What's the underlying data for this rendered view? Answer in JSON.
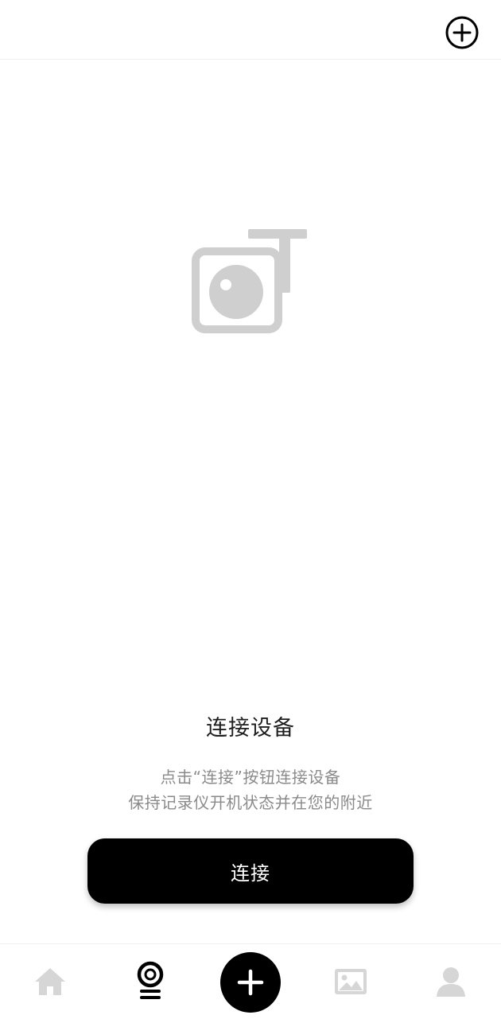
{
  "header": {
    "add_icon": "plus-circle-icon"
  },
  "hero": {
    "icon": "dashcam-icon"
  },
  "content": {
    "title": "连接设备",
    "hint_line1": "点击“连接”按钮连接设备",
    "hint_line2": "保持记录仪开机状态并在您的附近",
    "connect_label": "连接"
  },
  "tabbar": {
    "items": [
      {
        "icon": "home-icon",
        "active": false
      },
      {
        "icon": "dashcam-recorder-icon",
        "active": true
      },
      {
        "icon": "plus-icon",
        "active": false
      },
      {
        "icon": "gallery-icon",
        "active": false
      },
      {
        "icon": "profile-icon",
        "active": false
      }
    ]
  },
  "colors": {
    "primary": "#000000",
    "inactive": "#d6d6d6",
    "text_muted": "#8a8a8a",
    "illustration": "#cfcfcf"
  }
}
